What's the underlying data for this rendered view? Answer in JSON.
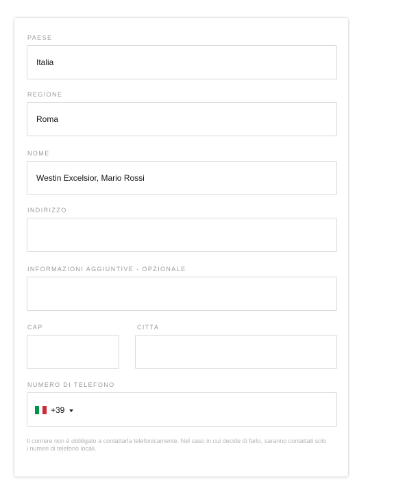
{
  "form": {
    "country": {
      "label": "PAESE",
      "value": "Italia"
    },
    "region": {
      "label": "REGIONE",
      "value": "Roma"
    },
    "name": {
      "label": "NOME",
      "value": "Westin Excelsior, Mario Rossi"
    },
    "address": {
      "label": "INDIRIZZO",
      "value": ""
    },
    "additional": {
      "label": "INFORMAZIONI AGGIUNTIVE - OPZIONALE",
      "value": ""
    },
    "zip": {
      "label": "CAP",
      "value": ""
    },
    "city": {
      "label": "CITTA",
      "value": ""
    },
    "phone": {
      "label": "NUMERO DI TELEFONO",
      "country_code": "+39",
      "flag_icon": "italy-flag-icon",
      "flag_colors": [
        "#009246",
        "#ffffff",
        "#ce2b37"
      ],
      "value": ""
    },
    "note": "Il corriere non è obbligato a contattarla telefonicamente. Nel caso in cui decide di farlo, saranno contattati solo i numeri di telefono locali."
  }
}
